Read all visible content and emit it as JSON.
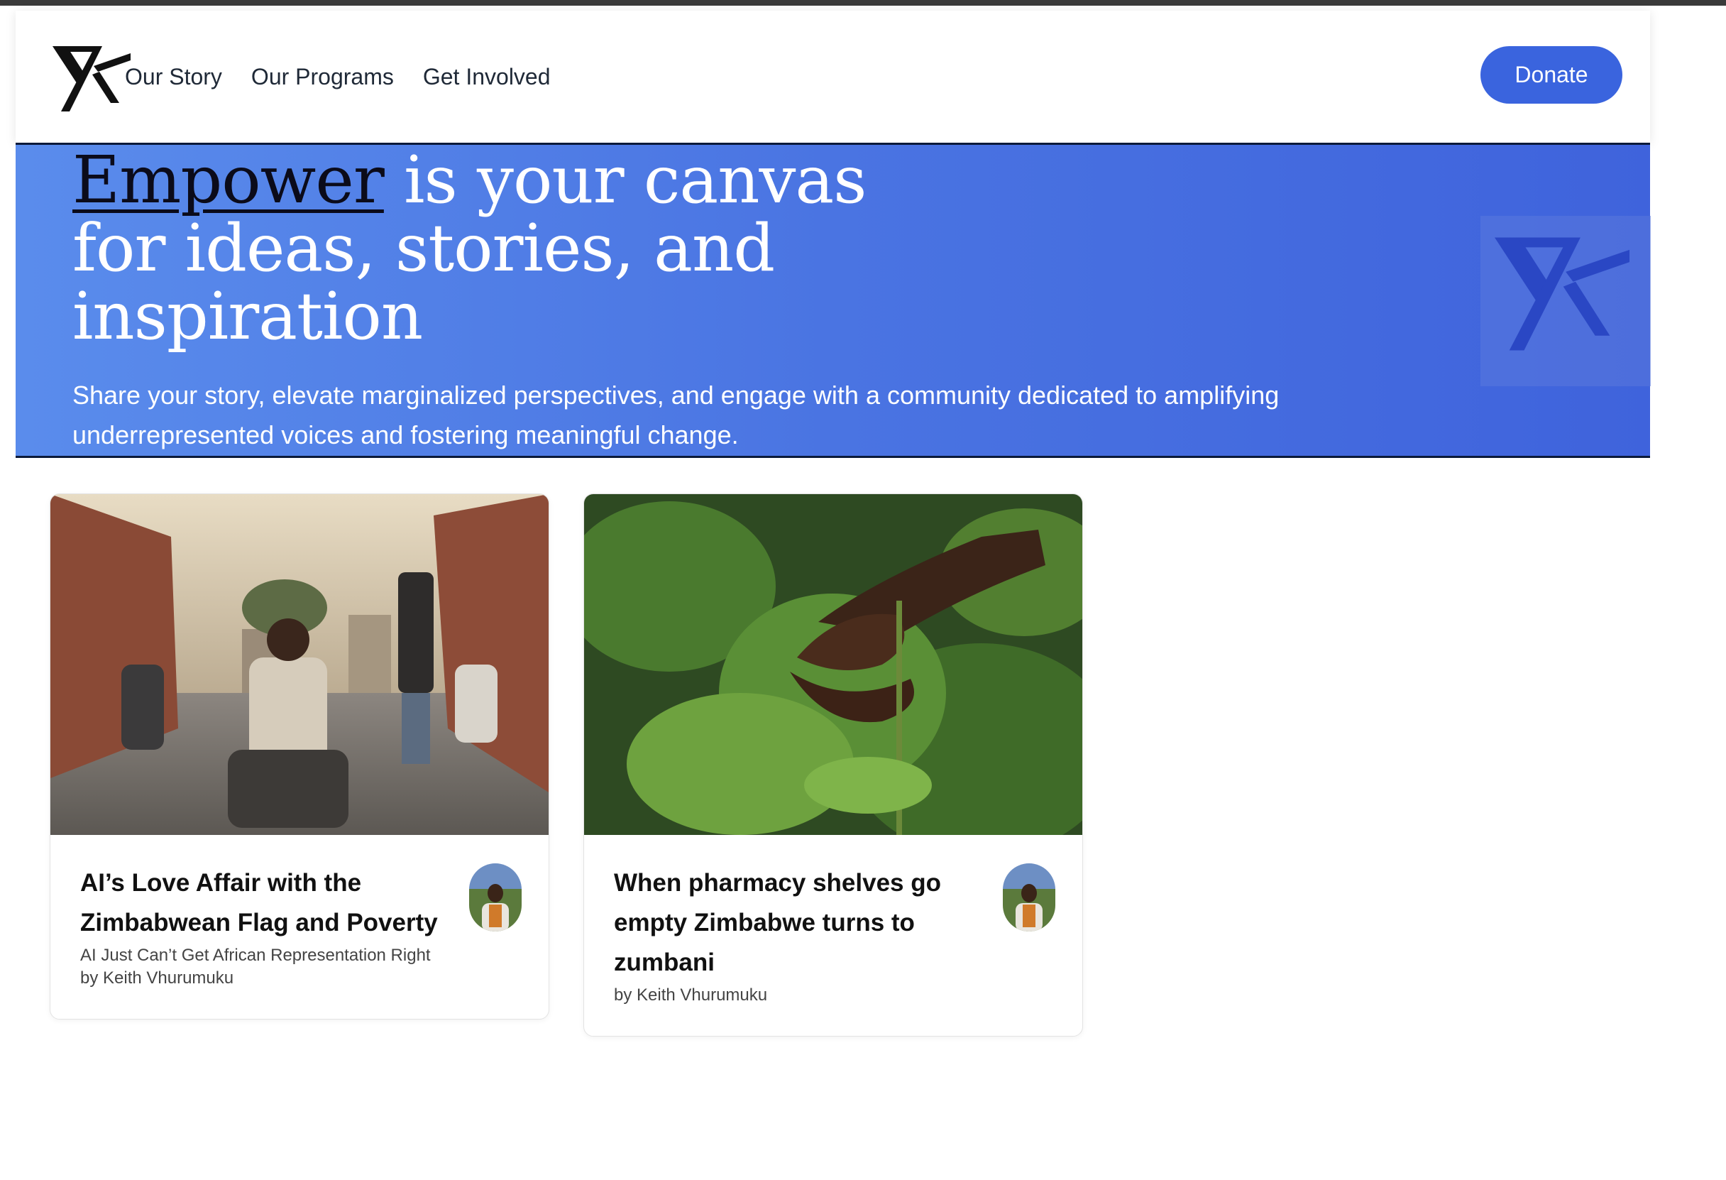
{
  "brand": {
    "logo_icon": "yk-logo-icon",
    "accent": "#3a64de"
  },
  "nav": {
    "links": [
      "Our Story",
      "Our Programs",
      "Get Involved"
    ],
    "donate_label": "Donate"
  },
  "hero": {
    "title_emphasis": "Empower",
    "title_rest": " is your canvas for ideas, stories, and inspiration",
    "subtitle": "Share your story, elevate marginalized perspectives, and engage with a community dedicated to amplifying underrepresented voices and fostering meaningful change.",
    "badge_icon": "yk-logo-icon",
    "gradient": [
      "#5a8cec",
      "#3f63dc"
    ]
  },
  "cards": [
    {
      "title": "AI’s Love Affair with the Zimbabwean Flag and Poverty",
      "subtitle": "AI Just Can’t Get African Representation Right",
      "byline": "by Keith Vhurumuku",
      "image_icon": "street-photo-image",
      "avatar_icon": "author-avatar"
    },
    {
      "title": "When pharmacy shelves go empty Zimbabwe turns to zumbani",
      "subtitle": "",
      "byline": "by Keith Vhurumuku",
      "image_icon": "plant-photo-image",
      "avatar_icon": "author-avatar"
    }
  ]
}
